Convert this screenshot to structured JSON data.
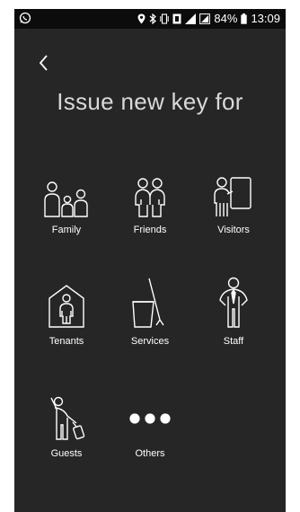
{
  "status_bar": {
    "battery": "84%",
    "time": "13:09"
  },
  "title": "Issue new key for",
  "options": [
    {
      "label": "Family",
      "icon": "family-icon"
    },
    {
      "label": "Friends",
      "icon": "friends-icon"
    },
    {
      "label": "Visitors",
      "icon": "visitors-icon"
    },
    {
      "label": "Tenants",
      "icon": "tenants-icon"
    },
    {
      "label": "Services",
      "icon": "services-icon"
    },
    {
      "label": "Staff",
      "icon": "staff-icon"
    },
    {
      "label": "Guests",
      "icon": "guests-icon"
    },
    {
      "label": "Others",
      "icon": "more-dots-icon"
    }
  ],
  "colors": {
    "background": "#262626",
    "status_bar": "#0c0c0c",
    "text": "#ffffff",
    "title": "#d9d9d9"
  }
}
